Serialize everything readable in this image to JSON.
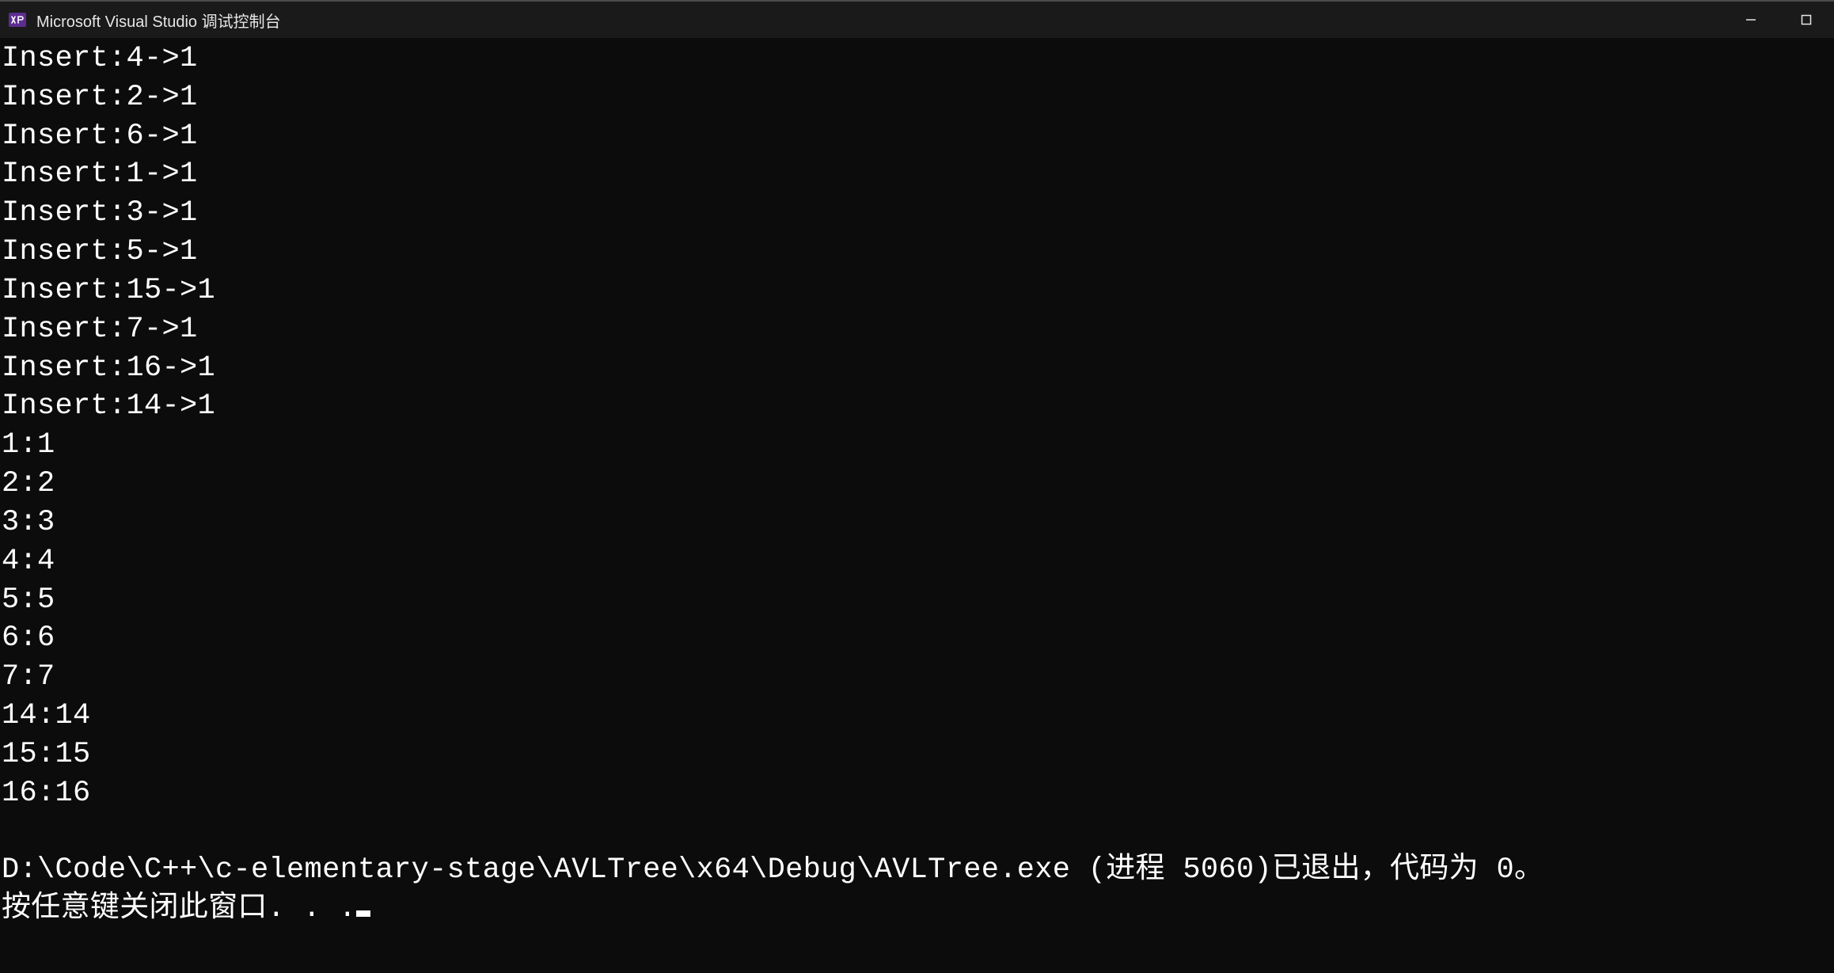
{
  "window": {
    "title": "Microsoft Visual Studio 调试控制台"
  },
  "console": {
    "insert_lines": [
      "Insert:4->1",
      "Insert:2->1",
      "Insert:6->1",
      "Insert:1->1",
      "Insert:3->1",
      "Insert:5->1",
      "Insert:15->1",
      "Insert:7->1",
      "Insert:16->1",
      "Insert:14->1"
    ],
    "kv_lines": [
      "1:1",
      "2:2",
      "3:3",
      "4:4",
      "5:5",
      "6:6",
      "7:7",
      "14:14",
      "15:15",
      "16:16"
    ],
    "blank_line": "",
    "exit_line": "D:\\Code\\C++\\c-elementary-stage\\AVLTree\\x64\\Debug\\AVLTree.exe (进程 5060)已退出，代码为 0。",
    "press_key_line": "按任意键关闭此窗口. . ."
  }
}
